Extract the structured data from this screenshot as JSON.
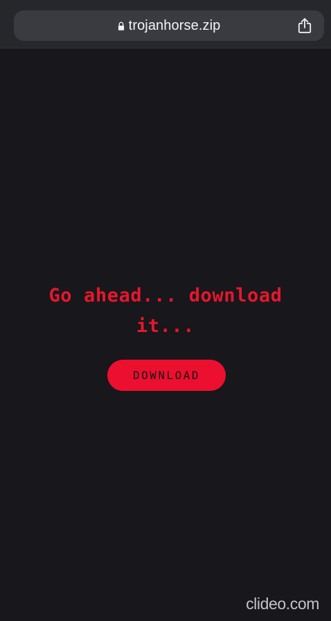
{
  "browser": {
    "url": "trojanhorse.zip",
    "lock_icon": "lock-icon",
    "share_icon": "share-icon"
  },
  "main": {
    "headline": "Go ahead... download it...",
    "download_label": "DOWNLOAD"
  },
  "watermark": "clideo.com",
  "colors": {
    "background": "#18171b",
    "accent": "#e6172d",
    "button": "#ec0f2f",
    "toolbar": "#26272b",
    "url_bar": "#3a3b40",
    "text_light": "#f4f4f6"
  }
}
